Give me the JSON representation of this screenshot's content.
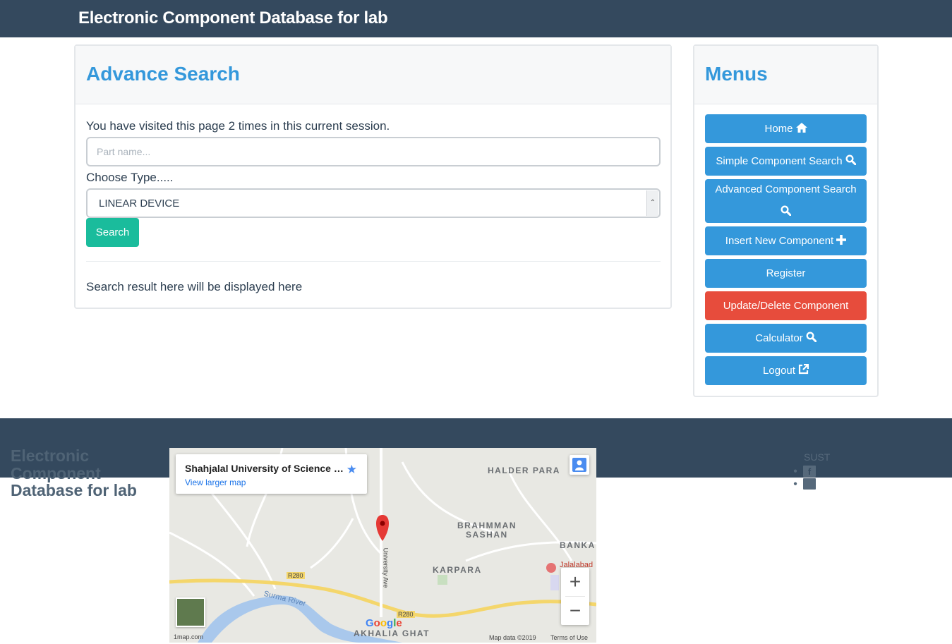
{
  "header": {
    "brand": "Electronic Component Database for lab"
  },
  "search_panel": {
    "title": "Advance Search",
    "visited_text": "You have visited this page 2 times in this current session.",
    "part_input": {
      "placeholder": "Part name...",
      "value": ""
    },
    "type_label": "Choose Type.....",
    "type_selected": "LINEAR DEVICE",
    "search_button": "Search",
    "result_text": "Search result here will be displayed here"
  },
  "menu_panel": {
    "title": "Menus",
    "items": [
      {
        "label": "Home",
        "icon": "home-icon",
        "color": "#3498db"
      },
      {
        "label": "Simple Component Search",
        "icon": "search-icon",
        "color": "#3498db"
      },
      {
        "label": "Advanced Component Search",
        "icon": "search-icon",
        "color": "#3498db"
      },
      {
        "label": "Insert New Component",
        "icon": "plus-icon",
        "color": "#3498db"
      },
      {
        "label": "Register",
        "icon": "",
        "color": "#3498db"
      },
      {
        "label": "Update/Delete Component",
        "icon": "",
        "color": "#e74c3c"
      },
      {
        "label": "Calculator",
        "icon": "search-icon",
        "color": "#3498db"
      },
      {
        "label": "Logout",
        "icon": "external-link-icon",
        "color": "#3498db"
      }
    ]
  },
  "footer": {
    "brand": "Electronic Component Database for lab",
    "sust_label": "SUST",
    "social_icons": [
      "facebook-icon",
      "comment-icon"
    ]
  },
  "map": {
    "place_title": "Shahjalal University of Science and ...",
    "view_larger": "View larger map",
    "labels": {
      "halder_para": "HALDER PARA",
      "brahmman": "BRAHMMAN",
      "sashan": "SASHAN",
      "banka": "BANKA",
      "karpara": "KARPARA",
      "akhalia": "AKHALIA GHAT",
      "jalalabad": "Jalalabad",
      "surma": "Surma River",
      "university_ave": "University Ave",
      "r280_a": "R280",
      "r280_b": "R280"
    },
    "attribution": {
      "site": "1map.com",
      "map_data": "Map data ©2019",
      "terms": "Terms of Use"
    },
    "google": "Google"
  },
  "colors": {
    "header_bg": "#34495e",
    "primary": "#3498db",
    "success": "#1abc9c",
    "danger": "#e74c3c"
  }
}
